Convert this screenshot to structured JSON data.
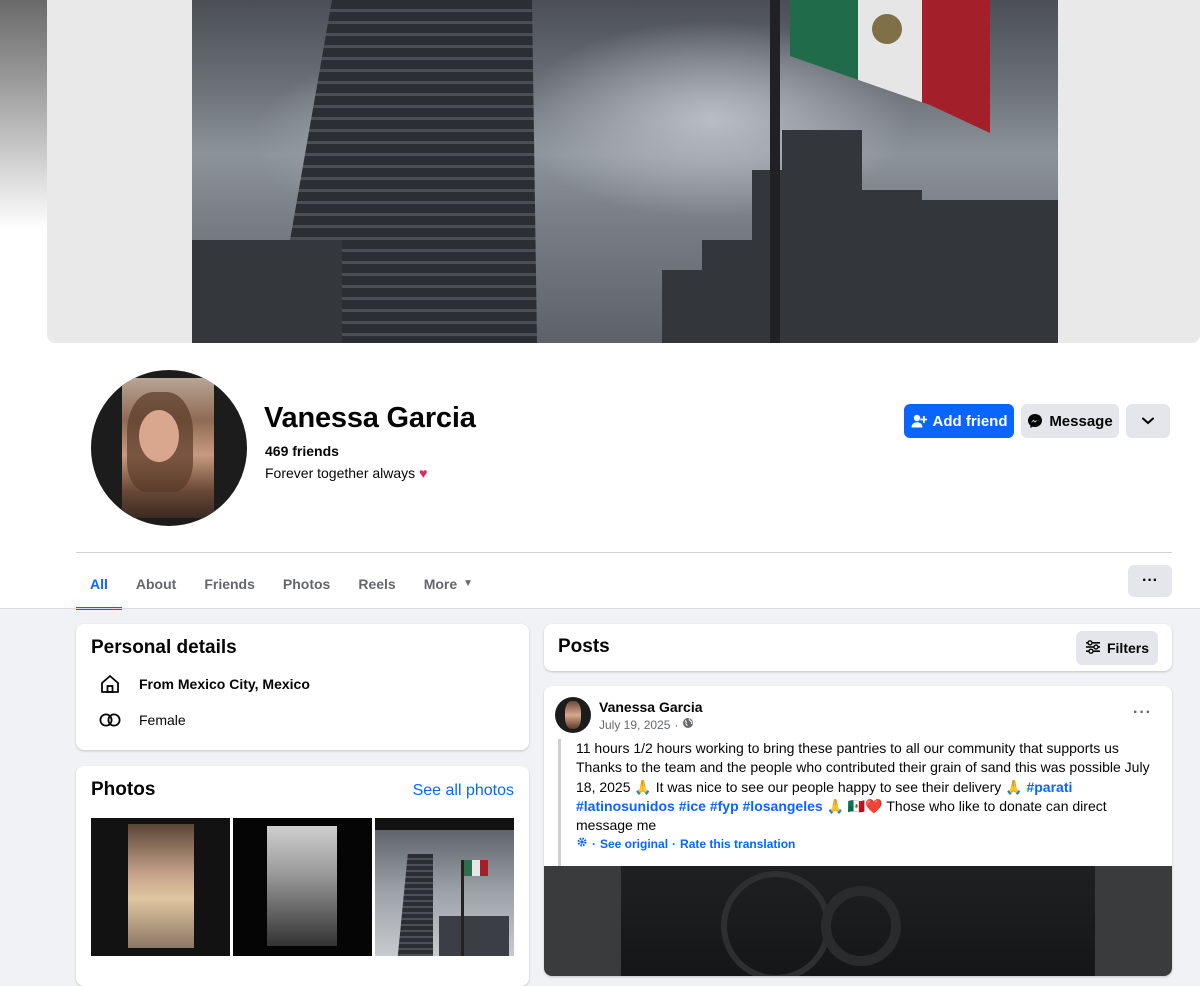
{
  "profile": {
    "name": "Vanessa Garcia",
    "friends": "469 friends",
    "bio": "Forever together always",
    "bio_emoji": "♥"
  },
  "actions": {
    "add_friend": "Add friend",
    "message": "Message",
    "more": "⌄"
  },
  "tabs": [
    {
      "label": "All",
      "active": true
    },
    {
      "label": "About",
      "active": false
    },
    {
      "label": "Friends",
      "active": false
    },
    {
      "label": "Photos",
      "active": false
    },
    {
      "label": "Reels",
      "active": false
    },
    {
      "label": "More",
      "active": false
    }
  ],
  "tabs_overflow": "···",
  "personal_details": {
    "title": "Personal details",
    "from_prefix": "From",
    "from_value": "Mexico City, Mexico",
    "gender": "Female"
  },
  "photos": {
    "title": "Photos",
    "see_all": "See all photos"
  },
  "posts": {
    "title": "Posts",
    "filters": "Filters"
  },
  "post": {
    "author": "Vanessa Garcia",
    "date": "July 19, 2025",
    "audience_icon": "globe-icon",
    "menu": "···",
    "text_main": "11 hours 1/2 hours working to bring these pantries to all our community that supports us Thanks to the team and the people who contributed their grain of sand this was possible July 18, 2025 🙏 It was nice to see our people happy to see their delivery 🙏 ",
    "tags": [
      "#parati",
      "#latinosunidos",
      "#ice",
      "#fyp",
      "#losangeles"
    ],
    "text_end": " 🙏 🇲🇽❤️ Those who like to donate can direct message me",
    "see_original": "See original",
    "separator": "·",
    "rate_translation": "Rate this translation"
  },
  "colors": {
    "accent": "#0866ff",
    "background": "#f0f2f5",
    "button_gray": "#e4e6eb",
    "heart": "#e4245a"
  }
}
